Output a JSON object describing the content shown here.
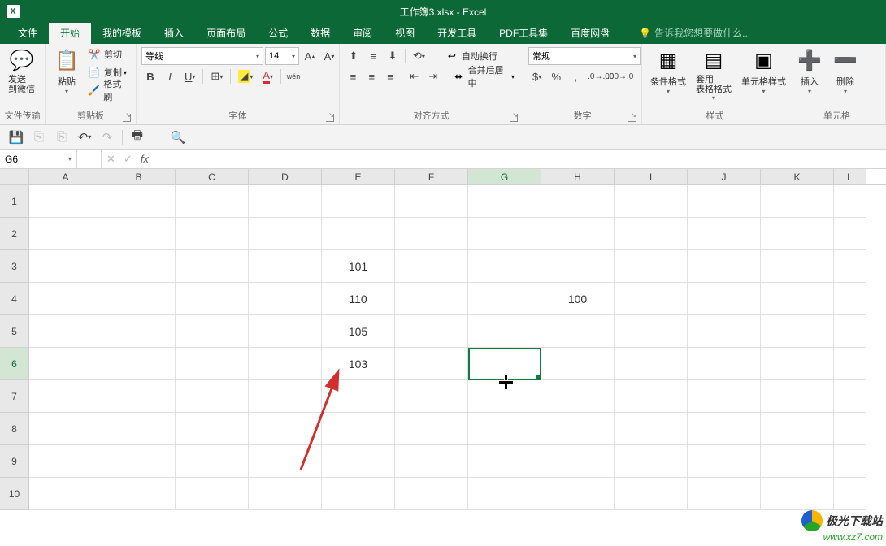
{
  "title": "工作簿3.xlsx - Excel",
  "tabs": [
    "文件",
    "开始",
    "我的模板",
    "插入",
    "页面布局",
    "公式",
    "数据",
    "审阅",
    "视图",
    "开发工具",
    "PDF工具集",
    "百度网盘"
  ],
  "active_tab": 1,
  "tell_me": "告诉我您想要做什么...",
  "ribbon": {
    "group1": {
      "label": "文件传输",
      "send_wechat": "发送\n到微信"
    },
    "clipboard": {
      "label": "剪贴板",
      "paste": "粘贴",
      "cut": "剪切",
      "copy": "复制",
      "format_painter": "格式刷"
    },
    "font": {
      "label": "字体",
      "name": "等线",
      "size": "14",
      "bold": "B",
      "italic": "I",
      "underline": "U"
    },
    "align": {
      "label": "对齐方式",
      "wrap": "自动换行",
      "merge": "合并后居中"
    },
    "number": {
      "label": "数字",
      "format": "常规"
    },
    "styles": {
      "label": "样式",
      "cond": "条件格式",
      "table": "套用\n表格格式",
      "cell": "单元格样式"
    },
    "cells_grp": {
      "label": "单元格",
      "insert": "插入",
      "delete": "删除"
    }
  },
  "name_box": "G6",
  "columns": [
    "A",
    "B",
    "C",
    "D",
    "E",
    "F",
    "G",
    "H",
    "I",
    "J",
    "K",
    "L"
  ],
  "rows": [
    "1",
    "2",
    "3",
    "4",
    "5",
    "6",
    "7",
    "8",
    "9",
    "10"
  ],
  "data": {
    "E3": "101",
    "E4": "110",
    "E5": "105",
    "E6": "103",
    "H4": "100"
  },
  "selected": {
    "col": 6,
    "row": 5
  },
  "watermark": {
    "line1": "极光下载站",
    "line2": "www.xz7.com"
  }
}
